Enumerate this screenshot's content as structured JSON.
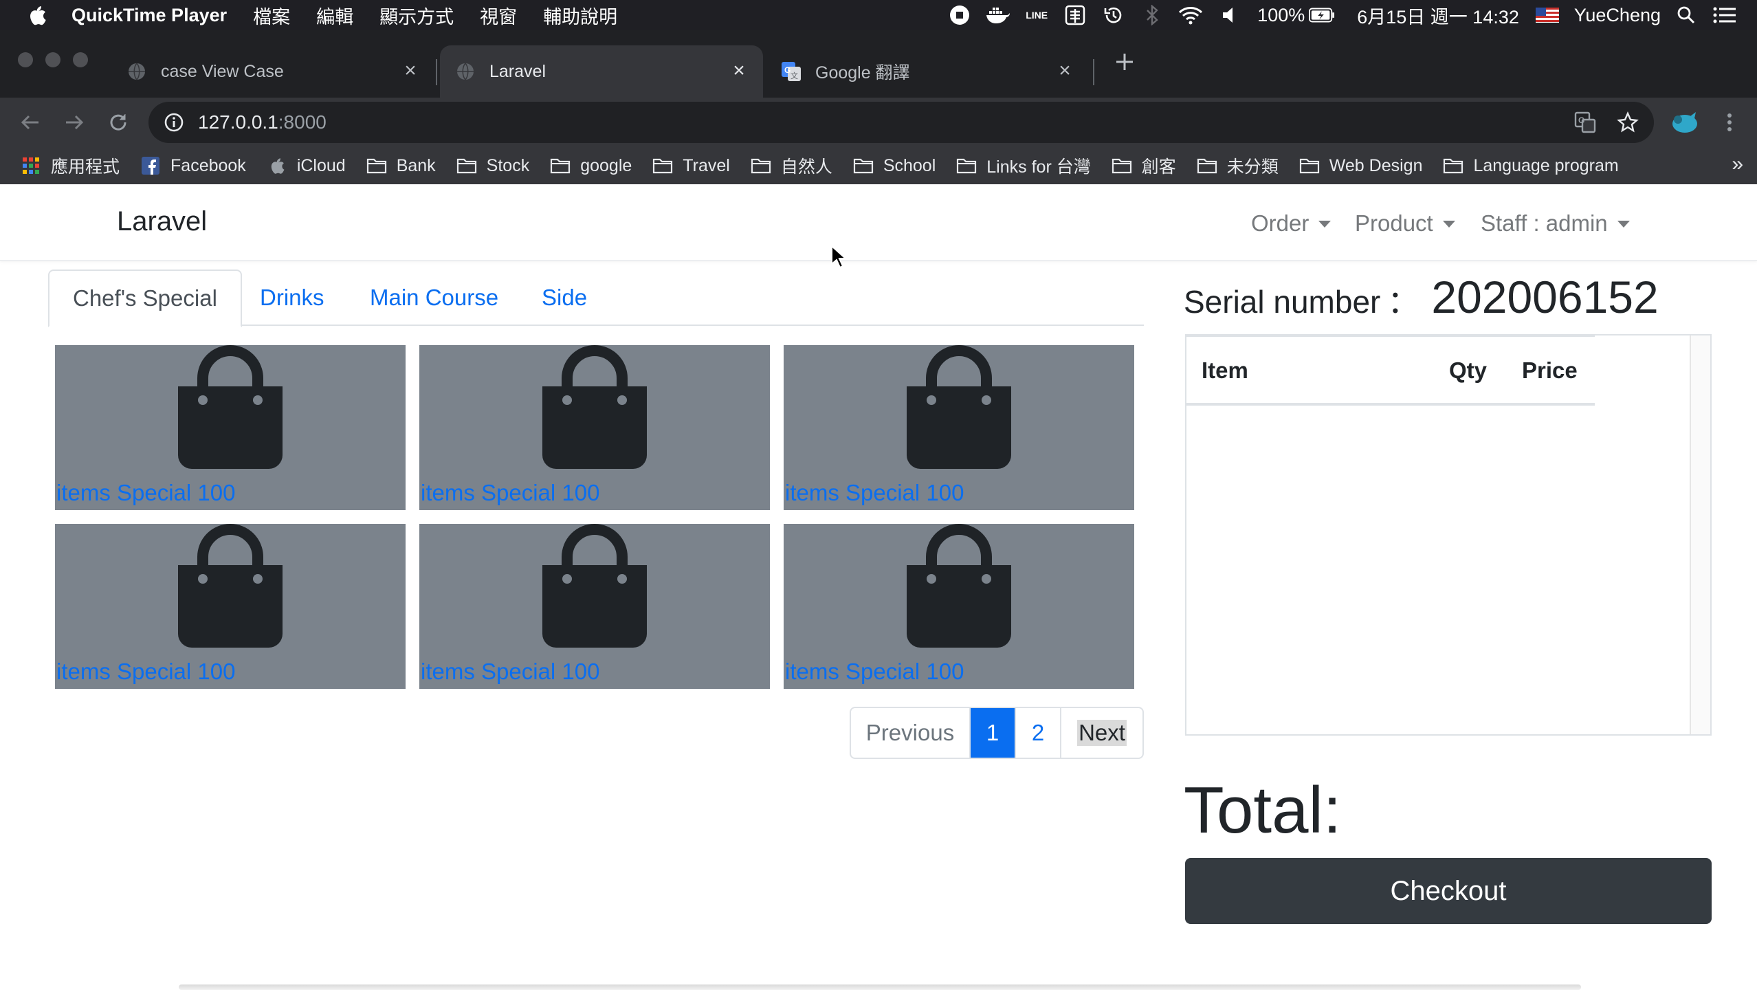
{
  "menubar": {
    "app_name": "QuickTime Player",
    "menus": [
      "檔案",
      "編輯",
      "顯示方式",
      "視窗",
      "輔助說明"
    ],
    "line_label": "LINE",
    "battery": "100%",
    "datetime": "6月15日 週一 14:32",
    "user": "YueCheng"
  },
  "browser": {
    "tabs": [
      {
        "title": "case View Case"
      },
      {
        "title": "Laravel"
      },
      {
        "title": "Google 翻譯"
      }
    ],
    "url_host": "127.0.0.1",
    "url_port": ":8000",
    "bookmarks": [
      {
        "label": "應用程式",
        "icon": "apps-grid-icon"
      },
      {
        "label": "Facebook",
        "icon": "facebook-icon"
      },
      {
        "label": "iCloud",
        "icon": "apple-icon"
      },
      {
        "label": "Bank",
        "icon": "folder-icon"
      },
      {
        "label": "Stock",
        "icon": "folder-icon"
      },
      {
        "label": "google",
        "icon": "folder-icon"
      },
      {
        "label": "Travel",
        "icon": "folder-icon"
      },
      {
        "label": "自然人",
        "icon": "folder-icon"
      },
      {
        "label": "School",
        "icon": "folder-icon"
      },
      {
        "label": "Links for 台灣",
        "icon": "folder-icon"
      },
      {
        "label": "創客",
        "icon": "folder-icon"
      },
      {
        "label": "未分類",
        "icon": "folder-icon"
      },
      {
        "label": "Web Design",
        "icon": "folder-icon"
      },
      {
        "label": "Language program",
        "icon": "folder-icon"
      }
    ],
    "bookmarks_more": "»"
  },
  "page": {
    "brand": "Laravel",
    "nav": {
      "order": "Order",
      "product": "Product",
      "staff": "Staff : admin"
    },
    "categories": [
      {
        "label": "Chef's Special",
        "active": true
      },
      {
        "label": "Drinks",
        "active": false
      },
      {
        "label": "Main Course",
        "active": false
      },
      {
        "label": "Side",
        "active": false
      }
    ],
    "products": [
      {
        "label": "items Special 100"
      },
      {
        "label": "items Special 100"
      },
      {
        "label": "items Special 100"
      },
      {
        "label": "items Special 100"
      },
      {
        "label": "items Special 100"
      },
      {
        "label": "items Special 100"
      }
    ],
    "pagination": {
      "previous": "Previous",
      "pages": [
        "1",
        "2"
      ],
      "current": "1",
      "next": "Next"
    },
    "order": {
      "serial_label": "Serial number",
      "serial_colon": "：",
      "serial_value": "202006152",
      "columns": [
        "Item",
        "Qty",
        "Price"
      ],
      "total_label": "Total:",
      "checkout": "Checkout"
    }
  },
  "colors": {
    "link": "#0a6ef0",
    "product_bg": "#7b838c",
    "bag": "#1f2327",
    "checkout_bg": "#343a40"
  }
}
